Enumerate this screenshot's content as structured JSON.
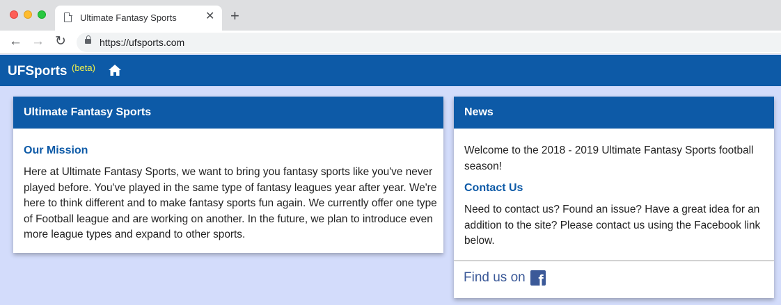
{
  "browser": {
    "tab_title": "Ultimate Fantasy Sports",
    "tab_close": "✕",
    "new_tab": "+",
    "back": "←",
    "forward": "→",
    "reload": "↻",
    "url": "https://ufsports.com"
  },
  "header": {
    "brand": "UFSports",
    "beta": "(beta)",
    "home_icon": "home-icon"
  },
  "mission_card": {
    "header": "Ultimate Fantasy Sports",
    "title": "Our Mission",
    "text": "Here at Ultimate Fantasy Sports, we want to bring you fantasy sports like you've never played before. You've played in the same type of fantasy leagues year after year. We're here to think different and to make fantasy sports fun again. We currently offer one type of Football league and are working on another. In the future, we plan to introduce even more league types and expand to other sports."
  },
  "news_card": {
    "header": "News",
    "welcome": "Welcome to the 2018 - 2019 Ultimate Fantasy Sports football season!",
    "contact_title": "Contact Us",
    "contact_text": "Need to contact us? Found an issue? Have a great idea for an addition to the site? Please contact us using the Facebook link below.",
    "find_us": "Find us on",
    "fb_letter": "f"
  },
  "colors": {
    "brand_blue": "#0d5aa7",
    "page_bg": "#d3dcfb",
    "beta_yellow": "#f2f24a",
    "facebook_blue": "#3b5998"
  }
}
